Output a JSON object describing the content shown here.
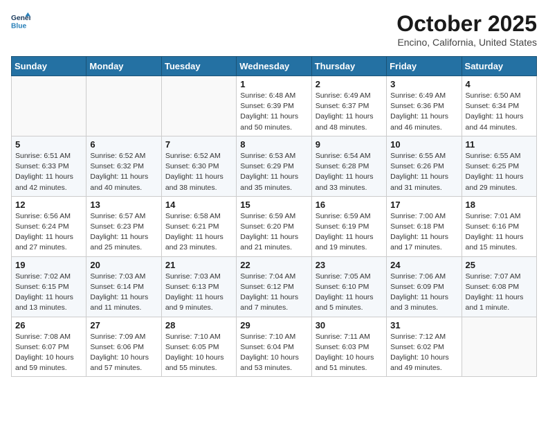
{
  "header": {
    "logo_line1": "General",
    "logo_line2": "Blue",
    "month": "October 2025",
    "location": "Encino, California, United States"
  },
  "weekdays": [
    "Sunday",
    "Monday",
    "Tuesday",
    "Wednesday",
    "Thursday",
    "Friday",
    "Saturday"
  ],
  "weeks": [
    [
      {
        "day": "",
        "info": ""
      },
      {
        "day": "",
        "info": ""
      },
      {
        "day": "",
        "info": ""
      },
      {
        "day": "1",
        "info": "Sunrise: 6:48 AM\nSunset: 6:39 PM\nDaylight: 11 hours\nand 50 minutes."
      },
      {
        "day": "2",
        "info": "Sunrise: 6:49 AM\nSunset: 6:37 PM\nDaylight: 11 hours\nand 48 minutes."
      },
      {
        "day": "3",
        "info": "Sunrise: 6:49 AM\nSunset: 6:36 PM\nDaylight: 11 hours\nand 46 minutes."
      },
      {
        "day": "4",
        "info": "Sunrise: 6:50 AM\nSunset: 6:34 PM\nDaylight: 11 hours\nand 44 minutes."
      }
    ],
    [
      {
        "day": "5",
        "info": "Sunrise: 6:51 AM\nSunset: 6:33 PM\nDaylight: 11 hours\nand 42 minutes."
      },
      {
        "day": "6",
        "info": "Sunrise: 6:52 AM\nSunset: 6:32 PM\nDaylight: 11 hours\nand 40 minutes."
      },
      {
        "day": "7",
        "info": "Sunrise: 6:52 AM\nSunset: 6:30 PM\nDaylight: 11 hours\nand 38 minutes."
      },
      {
        "day": "8",
        "info": "Sunrise: 6:53 AM\nSunset: 6:29 PM\nDaylight: 11 hours\nand 35 minutes."
      },
      {
        "day": "9",
        "info": "Sunrise: 6:54 AM\nSunset: 6:28 PM\nDaylight: 11 hours\nand 33 minutes."
      },
      {
        "day": "10",
        "info": "Sunrise: 6:55 AM\nSunset: 6:26 PM\nDaylight: 11 hours\nand 31 minutes."
      },
      {
        "day": "11",
        "info": "Sunrise: 6:55 AM\nSunset: 6:25 PM\nDaylight: 11 hours\nand 29 minutes."
      }
    ],
    [
      {
        "day": "12",
        "info": "Sunrise: 6:56 AM\nSunset: 6:24 PM\nDaylight: 11 hours\nand 27 minutes."
      },
      {
        "day": "13",
        "info": "Sunrise: 6:57 AM\nSunset: 6:23 PM\nDaylight: 11 hours\nand 25 minutes."
      },
      {
        "day": "14",
        "info": "Sunrise: 6:58 AM\nSunset: 6:21 PM\nDaylight: 11 hours\nand 23 minutes."
      },
      {
        "day": "15",
        "info": "Sunrise: 6:59 AM\nSunset: 6:20 PM\nDaylight: 11 hours\nand 21 minutes."
      },
      {
        "day": "16",
        "info": "Sunrise: 6:59 AM\nSunset: 6:19 PM\nDaylight: 11 hours\nand 19 minutes."
      },
      {
        "day": "17",
        "info": "Sunrise: 7:00 AM\nSunset: 6:18 PM\nDaylight: 11 hours\nand 17 minutes."
      },
      {
        "day": "18",
        "info": "Sunrise: 7:01 AM\nSunset: 6:16 PM\nDaylight: 11 hours\nand 15 minutes."
      }
    ],
    [
      {
        "day": "19",
        "info": "Sunrise: 7:02 AM\nSunset: 6:15 PM\nDaylight: 11 hours\nand 13 minutes."
      },
      {
        "day": "20",
        "info": "Sunrise: 7:03 AM\nSunset: 6:14 PM\nDaylight: 11 hours\nand 11 minutes."
      },
      {
        "day": "21",
        "info": "Sunrise: 7:03 AM\nSunset: 6:13 PM\nDaylight: 11 hours\nand 9 minutes."
      },
      {
        "day": "22",
        "info": "Sunrise: 7:04 AM\nSunset: 6:12 PM\nDaylight: 11 hours\nand 7 minutes."
      },
      {
        "day": "23",
        "info": "Sunrise: 7:05 AM\nSunset: 6:10 PM\nDaylight: 11 hours\nand 5 minutes."
      },
      {
        "day": "24",
        "info": "Sunrise: 7:06 AM\nSunset: 6:09 PM\nDaylight: 11 hours\nand 3 minutes."
      },
      {
        "day": "25",
        "info": "Sunrise: 7:07 AM\nSunset: 6:08 PM\nDaylight: 11 hours\nand 1 minute."
      }
    ],
    [
      {
        "day": "26",
        "info": "Sunrise: 7:08 AM\nSunset: 6:07 PM\nDaylight: 10 hours\nand 59 minutes."
      },
      {
        "day": "27",
        "info": "Sunrise: 7:09 AM\nSunset: 6:06 PM\nDaylight: 10 hours\nand 57 minutes."
      },
      {
        "day": "28",
        "info": "Sunrise: 7:10 AM\nSunset: 6:05 PM\nDaylight: 10 hours\nand 55 minutes."
      },
      {
        "day": "29",
        "info": "Sunrise: 7:10 AM\nSunset: 6:04 PM\nDaylight: 10 hours\nand 53 minutes."
      },
      {
        "day": "30",
        "info": "Sunrise: 7:11 AM\nSunset: 6:03 PM\nDaylight: 10 hours\nand 51 minutes."
      },
      {
        "day": "31",
        "info": "Sunrise: 7:12 AM\nSunset: 6:02 PM\nDaylight: 10 hours\nand 49 minutes."
      },
      {
        "day": "",
        "info": ""
      }
    ]
  ]
}
